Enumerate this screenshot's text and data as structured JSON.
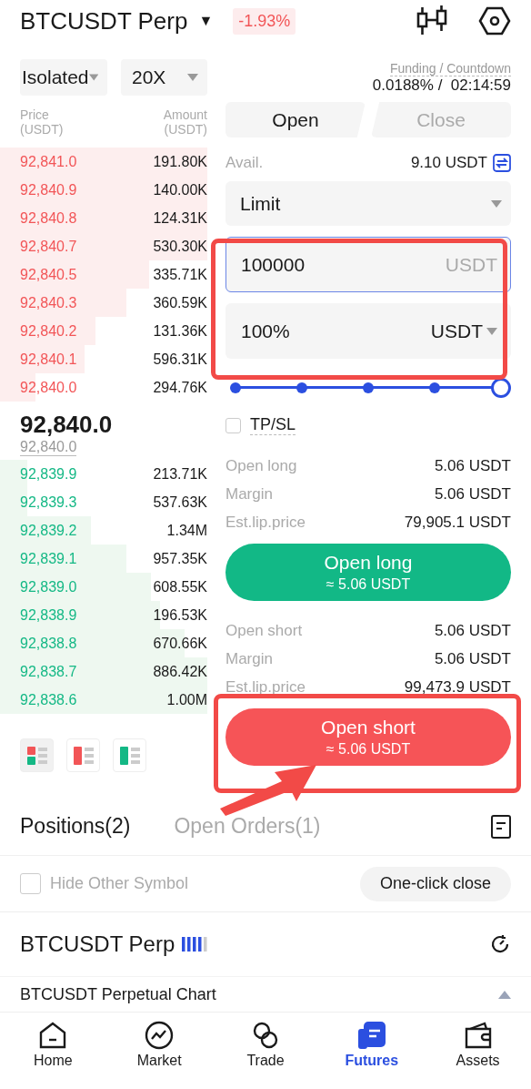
{
  "header": {
    "symbol": "BTCUSDT Perp",
    "caret": "▼",
    "change": "-1.93%"
  },
  "margin_mode": {
    "label": "Isolated"
  },
  "leverage": {
    "label": "20X"
  },
  "funding": {
    "label": "Funding / Countdown",
    "rate": "0.0188% /",
    "countdown": "02:14:59"
  },
  "order_book": {
    "price_header": "Price\n(USDT)",
    "amount_header": "Amount\n(USDT)",
    "asks": [
      {
        "price": "92,841.0",
        "amount": "191.80K"
      },
      {
        "price": "92,840.9",
        "amount": "140.00K"
      },
      {
        "price": "92,840.8",
        "amount": "124.31K"
      },
      {
        "price": "92,840.7",
        "amount": "530.30K"
      },
      {
        "price": "92,840.5",
        "amount": "335.71K"
      },
      {
        "price": "92,840.3",
        "amount": "360.59K"
      },
      {
        "price": "92,840.2",
        "amount": "131.36K"
      },
      {
        "price": "92,840.1",
        "amount": "596.31K"
      },
      {
        "price": "92,840.0",
        "amount": "294.76K"
      }
    ],
    "last_price": "92,840.0",
    "mark_price": "92,840.0",
    "bids": [
      {
        "price": "92,839.9",
        "amount": "213.71K"
      },
      {
        "price": "92,839.3",
        "amount": "537.63K"
      },
      {
        "price": "92,839.2",
        "amount": "1.34M"
      },
      {
        "price": "92,839.1",
        "amount": "957.35K"
      },
      {
        "price": "92,839.0",
        "amount": "608.55K"
      },
      {
        "price": "92,838.9",
        "amount": "196.53K"
      },
      {
        "price": "92,838.8",
        "amount": "670.66K"
      },
      {
        "price": "92,838.7",
        "amount": "886.42K"
      },
      {
        "price": "92,838.6",
        "amount": "1.00M"
      }
    ],
    "views": [
      {
        "kind": "both",
        "selected": true
      },
      {
        "kind": "asks",
        "selected": false
      },
      {
        "kind": "bids",
        "selected": false
      }
    ]
  },
  "order_tabs": [
    {
      "label": "Open",
      "selected": true
    },
    {
      "label": "Close",
      "selected": false
    }
  ],
  "available": {
    "label": "Avail.",
    "value": "9.10 USDT"
  },
  "order_type": {
    "label": "Limit"
  },
  "price_field": {
    "value": "100000",
    "unit": "USDT"
  },
  "amount_field": {
    "value": "100%",
    "unit": "USDT"
  },
  "slider": {
    "level": 1
  },
  "tpsl": {
    "label": "TP/SL",
    "checked": false
  },
  "long_info": [
    {
      "label": "Open long",
      "value": "5.06 USDT"
    },
    {
      "label": "Margin",
      "value": "5.06 USDT"
    },
    {
      "label": "Est.lip.price",
      "value": "79,905.1 USDT"
    }
  ],
  "long_button": {
    "label": "Open long",
    "sub": "≈ 5.06 USDT"
  },
  "short_info": [
    {
      "label": "Open short",
      "value": "5.06 USDT"
    },
    {
      "label": "Margin",
      "value": "5.06 USDT"
    },
    {
      "label": "Est.lip.price",
      "value": "99,473.9 USDT"
    }
  ],
  "short_button": {
    "label": "Open short",
    "sub": "≈ 5.06 USDT"
  },
  "position_tabs": [
    {
      "label": "Positions(2)",
      "selected": true
    },
    {
      "label": "Open Orders(1)",
      "selected": false
    }
  ],
  "hide_other": {
    "label": "Hide Other Symbol",
    "checked": false
  },
  "one_click_close": {
    "label": "One-click close"
  },
  "position": {
    "symbol": "BTCUSDT Perp"
  },
  "chart_row": {
    "label": "BTCUSDT Perpetual Chart",
    "expanded": false
  },
  "nav": [
    {
      "label": "Home",
      "selected": false
    },
    {
      "label": "Market",
      "selected": false
    },
    {
      "label": "Trade",
      "selected": false
    },
    {
      "label": "Futures",
      "selected": true
    },
    {
      "label": "Assets",
      "selected": false
    }
  ]
}
